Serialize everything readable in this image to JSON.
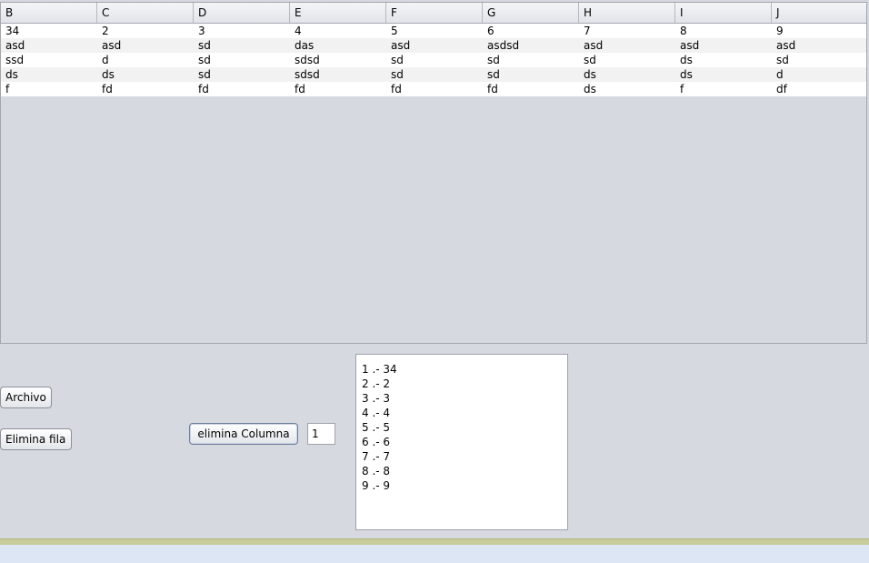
{
  "table": {
    "headers": [
      "B",
      "C",
      "D",
      "E",
      "F",
      "G",
      "H",
      "I",
      "J"
    ],
    "rows": [
      [
        "34",
        "2",
        "3",
        "4",
        "5",
        "6",
        "7",
        "8",
        "9"
      ],
      [
        "asd",
        "asd",
        "sd",
        "das",
        "asd",
        "asdsd",
        "asd",
        "asd",
        "asd"
      ],
      [
        "ssd",
        "d",
        "sd",
        "sdsd",
        "sd",
        "sd",
        "sd",
        "ds",
        "sd"
      ],
      [
        "ds",
        "ds",
        "sd",
        "sdsd",
        "sd",
        "sd",
        "ds",
        "ds",
        "d"
      ],
      [
        "f",
        "fd",
        "fd",
        "fd",
        "fd",
        "fd",
        "ds",
        "f",
        "df"
      ]
    ]
  },
  "buttons": {
    "archivo": "Archivo",
    "elimina_fila": "Elimina fila",
    "elimina_columna": "elimina Columna"
  },
  "column_input": {
    "value": "1"
  },
  "list": {
    "items": [
      "1 .- 34",
      "2 .- 2",
      "3 .- 3",
      "4 .- 4",
      "5 .- 5",
      "6 .- 6",
      "7 .- 7",
      "8 .- 8",
      "9 .- 9"
    ]
  },
  "colors": {
    "background": "#d6d9df",
    "bottom_strip": "#c7cc9a",
    "status_bar": "#dde6f4"
  }
}
